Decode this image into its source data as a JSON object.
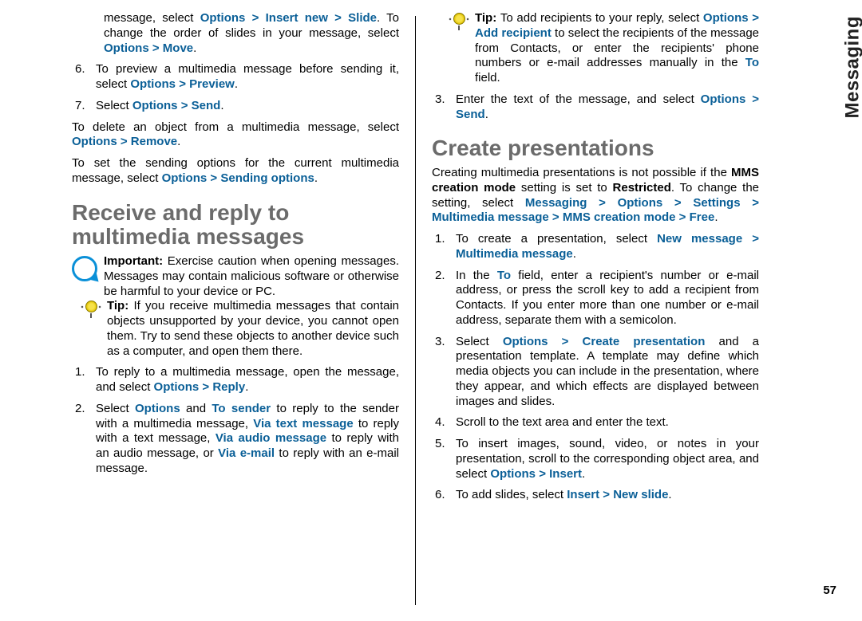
{
  "sidelabel": "Messaging",
  "pagenum": "57",
  "left": {
    "cont_step_a": {
      "pre": "message, select ",
      "l1": "Options",
      "g1": " > ",
      "l2": "Insert new",
      "g2": " > ",
      "l3": "Slide",
      "post1": ". To change the order of slides in your message, select ",
      "l4": "Options",
      "g3": " > ",
      "l5": "Move",
      "post2": "."
    },
    "cont_step_6": {
      "num": "6.",
      "pre": "To preview a multimedia message before sending it, select ",
      "l1": "Options",
      "g1": " > ",
      "l2": "Preview",
      "post": "."
    },
    "cont_step_7": {
      "num": "7.",
      "pre": "Select ",
      "l1": "Options",
      "g1": " > ",
      "l2": "Send",
      "post": "."
    },
    "para_delete": {
      "pre": "To delete an object from a multimedia message, select ",
      "l1": "Options",
      "g1": " > ",
      "l2": "Remove",
      "post": "."
    },
    "para_sendopt": {
      "pre": "To set the sending options for the current multimedia message, select ",
      "l1": "Options",
      "g1": " > ",
      "l2": "Sending options",
      "post": "."
    },
    "h2": "Receive and reply to multimedia messages",
    "important": {
      "label": "Important: ",
      "text": "Exercise caution when opening messages. Messages may contain malicious software or otherwise be harmful to your device or PC."
    },
    "tip1": {
      "label": "Tip: ",
      "text": "If you receive multimedia messages that contain objects unsupported by your device, you cannot open them. Try to send these objects to another device such as a computer, and open them there."
    },
    "step1": {
      "num": "1.",
      "pre": "To reply to a multimedia message, open the message, and select ",
      "l1": "Options",
      "g1": " > ",
      "l2": "Reply",
      "post": "."
    },
    "step2": {
      "num": "2.",
      "t1": "Select ",
      "l1": "Options",
      "t2": " and ",
      "l2": "To sender",
      "t3": " to reply to the sender with a multimedia message, ",
      "l3": "Via text message",
      "t4": " to reply with a text message, ",
      "l4": "Via audio message",
      "t5": " to reply with an audio message, or ",
      "l5": "Via e-mail",
      "t6": " to reply with an e-mail message."
    }
  },
  "right": {
    "tip2": {
      "label": "Tip: ",
      "t1": "To add recipients to your reply, select ",
      "l1": "Options",
      "g1": " > ",
      "l2": "Add recipient",
      "t2": " to select the recipients of the message from Contacts, or enter the recipients' phone numbers or e-mail addresses manually in the ",
      "l3": "To",
      "t3": " field."
    },
    "step3": {
      "num": "3.",
      "t1": "Enter the text of the message, and select ",
      "l1": "Options",
      "g1": " > ",
      "l2": "Send",
      "t2": "."
    },
    "h2": "Create presentations",
    "intro": {
      "t1": "Creating multimedia presentations is not possible if the ",
      "b1": "MMS creation mode",
      "t2": " setting is set to ",
      "b2": "Restricted",
      "t3": ". To change the setting, select ",
      "l1": "Messaging",
      "g1": " > ",
      "l2": "Options",
      "g2": " > ",
      "l3": "Settings",
      "g3": " > ",
      "l4": "Multimedia message",
      "g4": " > ",
      "l5": "MMS creation mode",
      "g5": " > ",
      "l6": "Free",
      "t4": "."
    },
    "p1": {
      "num": "1.",
      "t1": "To create a presentation, select ",
      "l1": "New message",
      "g1": " > ",
      "l2": "Multimedia message",
      "t2": "."
    },
    "p2": {
      "num": "2.",
      "t1": "In the ",
      "l1": "To",
      "t2": " field, enter a recipient's number or e-mail address, or press the scroll key to add a recipient from Contacts. If you enter more than one number or e-mail address, separate them with a semicolon."
    },
    "p3": {
      "num": "3.",
      "t1": "Select ",
      "l1": "Options",
      "g1": " > ",
      "l2": "Create presentation",
      "t2": " and a presentation template. A template may define which media objects you can include in the presentation, where they appear, and which effects are displayed between images and slides."
    },
    "p4": {
      "num": "4.",
      "t1": "Scroll to the text area and enter the text."
    },
    "p5": {
      "num": "5.",
      "t1": "To insert images, sound, video, or notes in your presentation, scroll to the corresponding object area, and select ",
      "l1": "Options",
      "g1": " > ",
      "l2": "Insert",
      "t2": "."
    },
    "p6": {
      "num": "6.",
      "t1": "To add slides, select ",
      "l1": "Insert",
      "g1": " > ",
      "l2": "New slide",
      "t2": "."
    }
  }
}
